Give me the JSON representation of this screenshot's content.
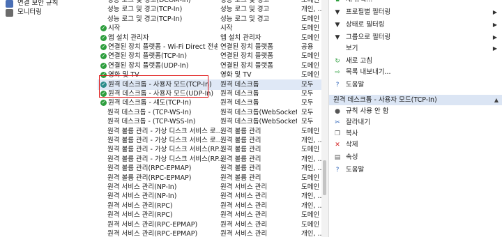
{
  "tree": {
    "items": [
      {
        "label": "연결 보안 규칙"
      },
      {
        "label": "모니터링"
      }
    ]
  },
  "rules": [
    {
      "name": "성능 로그 및 경고(DCOM-In)",
      "group": "성능 로그 및 경고",
      "profile": "도메인",
      "enabled": false
    },
    {
      "name": "성능 로그 및 경고(TCP-In)",
      "group": "성능 로그 및 경고",
      "profile": "개인, ...",
      "enabled": false
    },
    {
      "name": "성능 로그 및 경고(TCP-In)",
      "group": "성능 로그 및 경고",
      "profile": "도메인",
      "enabled": false
    },
    {
      "name": "시작",
      "group": "시작",
      "profile": "도메인",
      "enabled": true
    },
    {
      "name": "앱 설치 관리자",
      "group": "앱 설치 관리자",
      "profile": "도메인",
      "enabled": true
    },
    {
      "name": "연결된 장치 플랫폼 - Wi-Fi Direct 전송(...",
      "group": "연결된 장치 플랫폼",
      "profile": "공용",
      "enabled": true
    },
    {
      "name": "연결된 장치 플랫폼(TCP-In)",
      "group": "연결된 장치 플랫폼",
      "profile": "도메인",
      "enabled": true
    },
    {
      "name": "연결된 장치 플랫폼(UDP-In)",
      "group": "연결된 장치 플랫폼",
      "profile": "도메인",
      "enabled": true
    },
    {
      "name": "영화 및 TV",
      "group": "영화 및 TV",
      "profile": "도메인",
      "enabled": true
    },
    {
      "name": "원격 데스크톱 - 사용자 모드(TCP-In)",
      "group": "원격 데스크톱",
      "profile": "모두",
      "enabled": true,
      "selected": true
    },
    {
      "name": "원격 데스크톱 - 사용자 모드(UDP-In)",
      "group": "원격 데스크톱",
      "profile": "모두",
      "enabled": true
    },
    {
      "name": "원격 데스크톱 - 섀도(TCP-In)",
      "group": "원격 데스크톱",
      "profile": "모두",
      "enabled": true
    },
    {
      "name": "원격 데스크톱 - (TCP-WS-In)",
      "group": "원격 데스크톱(WebSocket)",
      "profile": "모두",
      "enabled": false
    },
    {
      "name": "원격 데스크톱 - (TCP-WSS-In)",
      "group": "원격 데스크톱(WebSocket)",
      "profile": "모두",
      "enabled": false
    },
    {
      "name": "원격 볼륨 관리 - 가상 디스크 서비스 로...",
      "group": "원격 볼륨 관리",
      "profile": "도메인",
      "enabled": false
    },
    {
      "name": "원격 볼륨 관리 - 가상 디스크 서비스 로...",
      "group": "원격 볼륨 관리",
      "profile": "개인, ...",
      "enabled": false
    },
    {
      "name": "원격 볼륨 관리 - 가상 디스크 서비스(RP...",
      "group": "원격 볼륨 관리",
      "profile": "도메인",
      "enabled": false
    },
    {
      "name": "원격 볼륨 관리 - 가상 디스크 서비스(RP...",
      "group": "원격 볼륨 관리",
      "profile": "개인, ...",
      "enabled": false
    },
    {
      "name": "원격 볼륨 관리(RPC-EPMAP)",
      "group": "원격 볼륨 관리",
      "profile": "개인, ...",
      "enabled": false
    },
    {
      "name": "원격 볼륨 관리(RPC-EPMAP)",
      "group": "원격 볼륨 관리",
      "profile": "도메인",
      "enabled": false
    },
    {
      "name": "원격 서비스 관리(NP-In)",
      "group": "원격 서비스 관리",
      "profile": "도메인",
      "enabled": false
    },
    {
      "name": "원격 서비스 관리(NP-In)",
      "group": "원격 서비스 관리",
      "profile": "개인, ...",
      "enabled": false
    },
    {
      "name": "원격 서비스 관리(RPC)",
      "group": "원격 서비스 관리",
      "profile": "개인, ...",
      "enabled": false
    },
    {
      "name": "원격 서비스 관리(RPC)",
      "group": "원격 서비스 관리",
      "profile": "도메인",
      "enabled": false
    },
    {
      "name": "원격 서비스 관리(RPC-EPMAP)",
      "group": "원격 서비스 관리",
      "profile": "도메인",
      "enabled": false
    },
    {
      "name": "원격 서비스 관리(RPC-EPMAP)",
      "group": "원격 서비스 관리",
      "profile": "개인, ...",
      "enabled": false
    }
  ],
  "actions": {
    "top": [
      {
        "label": "새 규칙...",
        "icon": "new-rule-icon",
        "glyph": "▪",
        "color": "#2e9e3e",
        "arrow": ""
      },
      {
        "label": "프로필별 필터링",
        "icon": "filter-icon",
        "glyph": "▼",
        "color": "#333333",
        "arrow": "▶"
      },
      {
        "label": "상태로 필터링",
        "icon": "filter-icon",
        "glyph": "▼",
        "color": "#333333",
        "arrow": "▶"
      },
      {
        "label": "그룹으로 필터링",
        "icon": "filter-icon",
        "glyph": "▼",
        "color": "#333333",
        "arrow": "▶"
      },
      {
        "label": "보기",
        "icon": "",
        "glyph": "",
        "color": "#333333",
        "arrow": "▶"
      },
      {
        "label": "새로 고침",
        "icon": "refresh-icon",
        "glyph": "↻",
        "color": "#2e9e3e",
        "arrow": ""
      },
      {
        "label": "목록 내보내기...",
        "icon": "export-icon",
        "glyph": "⇨",
        "color": "#2e9e3e",
        "arrow": ""
      },
      {
        "label": "도움말",
        "icon": "help-icon",
        "glyph": "?",
        "color": "#2e63b8",
        "arrow": ""
      }
    ],
    "section_title": "원격 데스크톱 - 사용자 모드(TCP-In)",
    "bottom": [
      {
        "label": "규칙 사용 안 함",
        "icon": "disable-rule-icon",
        "glyph": "●",
        "color": "#555555"
      },
      {
        "label": "잘라내기",
        "icon": "cut-icon",
        "glyph": "✂",
        "color": "#2e63b8"
      },
      {
        "label": "복사",
        "icon": "copy-icon",
        "glyph": "❐",
        "color": "#555555"
      },
      {
        "label": "삭제",
        "icon": "delete-icon",
        "glyph": "✕",
        "color": "#d32424"
      },
      {
        "label": "속성",
        "icon": "properties-icon",
        "glyph": "▤",
        "color": "#555555"
      },
      {
        "label": "도움말",
        "icon": "help-icon",
        "glyph": "?",
        "color": "#2e63b8"
      }
    ]
  }
}
